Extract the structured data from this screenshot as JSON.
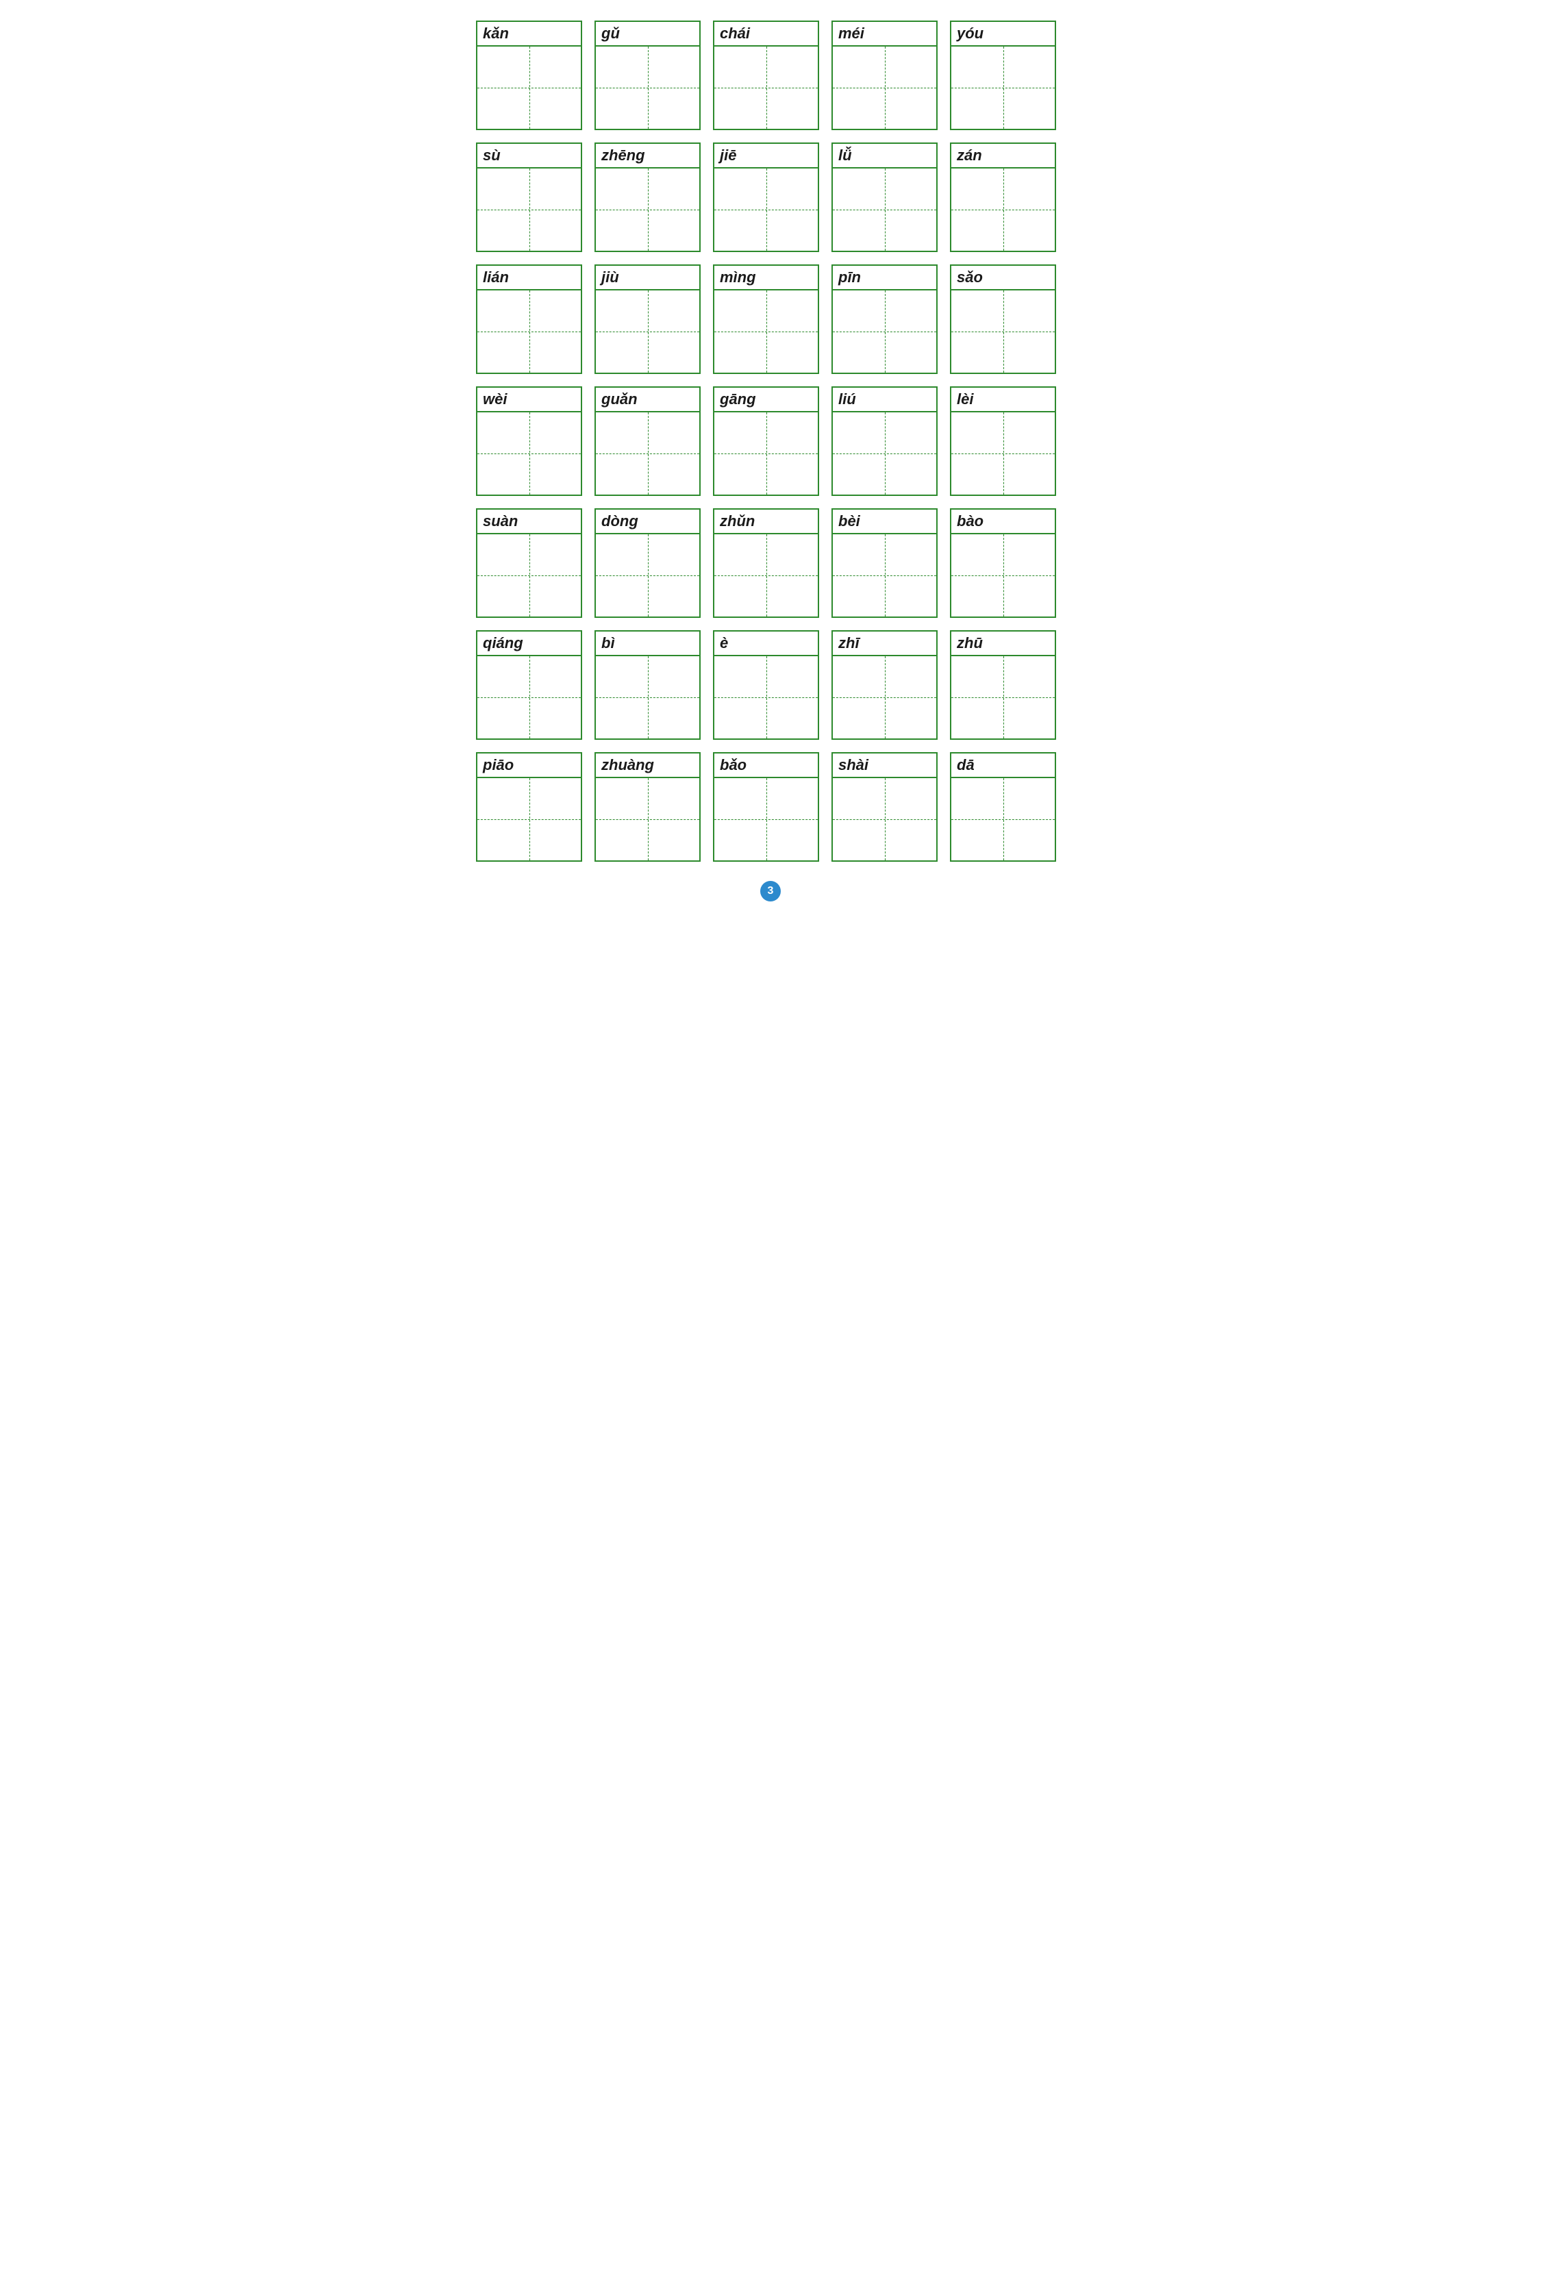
{
  "page": {
    "number": "3",
    "rows": [
      [
        {
          "label": "kǎn"
        },
        {
          "label": "gǔ"
        },
        {
          "label": "chái"
        },
        {
          "label": "méi"
        },
        {
          "label": "yóu"
        }
      ],
      [
        {
          "label": "sù"
        },
        {
          "label": "zhēng"
        },
        {
          "label": "jiē"
        },
        {
          "label": "lǚ"
        },
        {
          "label": "zán"
        }
      ],
      [
        {
          "label": "lián"
        },
        {
          "label": "jiù"
        },
        {
          "label": "mìng"
        },
        {
          "label": "pīn"
        },
        {
          "label": "sǎo"
        }
      ],
      [
        {
          "label": "wèi"
        },
        {
          "label": "guǎn"
        },
        {
          "label": "gāng"
        },
        {
          "label": "liú"
        },
        {
          "label": "lèi"
        }
      ],
      [
        {
          "label": "suàn"
        },
        {
          "label": "dòng"
        },
        {
          "label": "zhǔn"
        },
        {
          "label": "bèi"
        },
        {
          "label": "bào"
        }
      ],
      [
        {
          "label": "qiáng"
        },
        {
          "label": "bì"
        },
        {
          "label": "è"
        },
        {
          "label": "zhī"
        },
        {
          "label": "zhū"
        }
      ],
      [
        {
          "label": "piāo"
        },
        {
          "label": "zhuàng"
        },
        {
          "label": "bǎo"
        },
        {
          "label": "shài"
        },
        {
          "label": "dā"
        }
      ]
    ]
  }
}
